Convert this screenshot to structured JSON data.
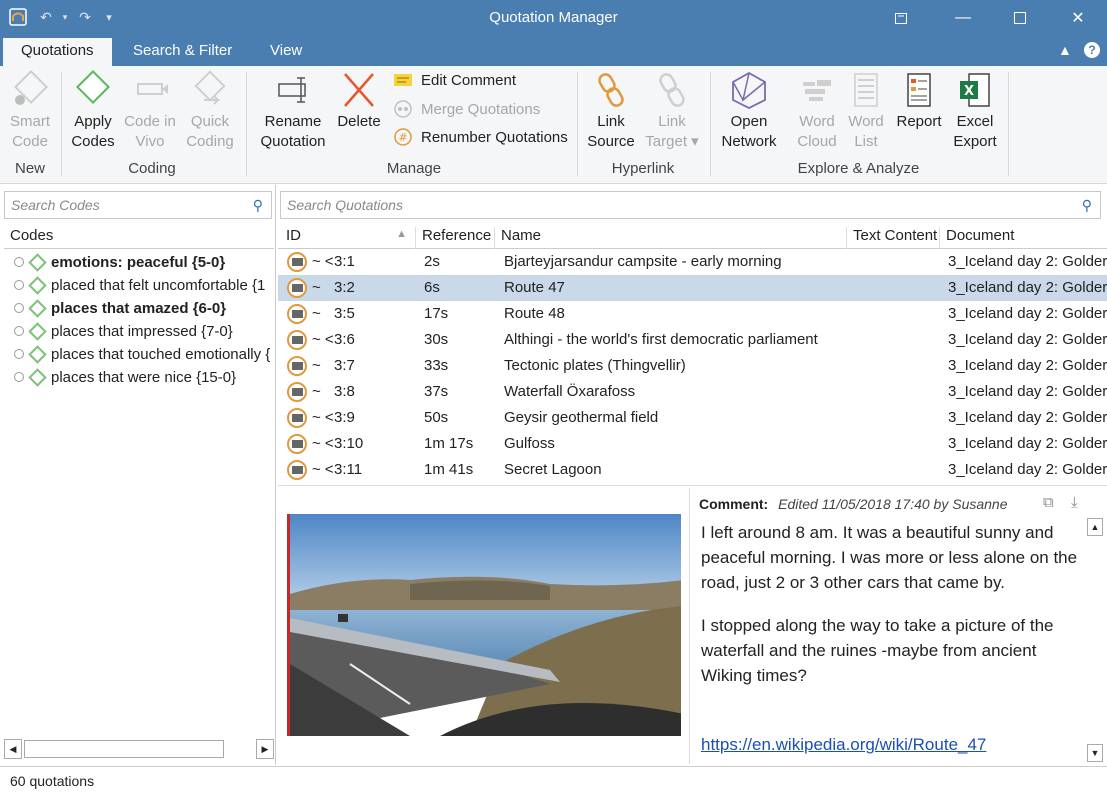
{
  "window": {
    "title": "Quotation Manager"
  },
  "tabs": [
    {
      "label": "Quotations"
    },
    {
      "label": "Search & Filter"
    },
    {
      "label": "View"
    }
  ],
  "ribbon": {
    "smart_code": "Smart\nCode",
    "apply_codes": "Apply\nCodes",
    "code_in_vivo": "Code in\nVivo",
    "quick_coding": "Quick\nCoding",
    "rename_quotation": "Rename\nQuotation",
    "delete": "Delete",
    "edit_comment": "Edit Comment",
    "merge_quotations": "Merge Quotations",
    "renumber_quotations": "Renumber Quotations",
    "link_source": "Link\nSource",
    "link_target": "Link\nTarget ▾",
    "open_network": "Open\nNetwork",
    "word_cloud": "Word\nCloud",
    "word_list": "Word\nList",
    "report": "Report",
    "excel_export": "Excel\nExport",
    "groups": {
      "new": "New",
      "coding": "Coding",
      "manage": "Manage",
      "hyperlink": "Hyperlink",
      "explore": "Explore & Analyze"
    }
  },
  "codes": {
    "search_placeholder": "Search Codes",
    "header": "Codes",
    "items": [
      {
        "label": "emotions: peaceful {5-0}",
        "bold": true
      },
      {
        "label": "placed that felt uncomfortable {1",
        "bold": false
      },
      {
        "label": "places that amazed {6-0}",
        "bold": true
      },
      {
        "label": "places that impressed {7-0}",
        "bold": false
      },
      {
        "label": "places that touched emotionally {",
        "bold": false
      },
      {
        "label": "places that were nice {15-0}",
        "bold": false
      }
    ]
  },
  "quotations": {
    "search_placeholder": "Search Quotations",
    "columns": {
      "id": "ID",
      "reference": "Reference",
      "name": "Name",
      "text_content": "Text Content",
      "document": "Document"
    },
    "rows": [
      {
        "marks": "~ <",
        "id": "3:1",
        "reference": "2s",
        "name": "Bjarteyjarsandur campsite - early morning",
        "document": "3_Iceland day 2: Golder"
      },
      {
        "marks": "~",
        "id": "3:2",
        "reference": "6s",
        "name": "Route 47",
        "document": "3_Iceland day 2: Golder"
      },
      {
        "marks": "~",
        "id": "3:5",
        "reference": "17s",
        "name": "Route 48",
        "document": "3_Iceland day 2: Golder"
      },
      {
        "marks": "~ <",
        "id": "3:6",
        "reference": "30s",
        "name": "Althingi - the world's first democratic parliament",
        "document": "3_Iceland day 2: Golder"
      },
      {
        "marks": "~",
        "id": "3:7",
        "reference": "33s",
        "name": "Tectonic plates (Thingvellir)",
        "document": "3_Iceland day 2: Golder"
      },
      {
        "marks": "~",
        "id": "3:8",
        "reference": "37s",
        "name": "Waterfall Öxarafoss",
        "document": "3_Iceland day 2: Golder"
      },
      {
        "marks": "~ <",
        "id": "3:9",
        "reference": "50s",
        "name": "Geysir geothermal field",
        "document": "3_Iceland day 2: Golder"
      },
      {
        "marks": "~ <",
        "id": "3:10",
        "reference": "1m 17s",
        "name": "Gulfoss",
        "document": "3_Iceland day 2: Golder"
      },
      {
        "marks": "~ <",
        "id": "3:11",
        "reference": "1m 41s",
        "name": "Secret Lagoon",
        "document": "3_Iceland day 2: Golder"
      }
    ],
    "selected_index": 1
  },
  "comment": {
    "label": "Comment:",
    "meta": "Edited 11/05/2018 17:40 by Susanne",
    "paragraph1": "I left around 8 am. It was a beautiful sunny and peaceful morning. I was more or less alone on the road, just 2 or 3 other cars that came by.",
    "paragraph2": "I stopped along the way to take a picture of the waterfall and the ruines -maybe from ancient Wiking times?",
    "link": "https://en.wikipedia.org/wiki/Route_47"
  },
  "status": {
    "text": "60 quotations"
  }
}
